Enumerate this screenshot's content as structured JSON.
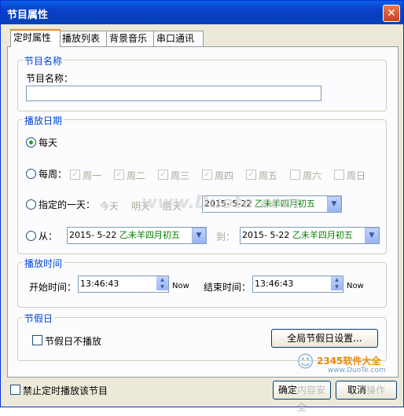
{
  "window": {
    "title": "节目属性",
    "close_glyph": "✕"
  },
  "tabs": [
    {
      "label": "定时属性"
    },
    {
      "label": "播放列表"
    },
    {
      "label": "背景音乐"
    },
    {
      "label": "串口通讯"
    }
  ],
  "program_name": {
    "group_label": "节目名称",
    "field_label": "节目名称：",
    "value": ""
  },
  "play_date": {
    "group_label": "播放日期",
    "everyday_label": "每天",
    "weekly_label": "每周：",
    "weekdays": [
      "周一",
      "周二",
      "周三",
      "周四",
      "周五",
      "周六",
      "周日"
    ],
    "weekdays_checked": [
      true,
      true,
      true,
      true,
      true,
      false,
      false
    ],
    "specific_label": "指定的一天：",
    "quick_days": [
      "今天",
      "明天",
      "后天"
    ],
    "specific_date": "2015- 5-22",
    "specific_lunar": "乙未羊四月初五",
    "from_label": "从：",
    "from_date": "2015- 5-22",
    "from_lunar": "乙未羊四月初五",
    "to_label": "到：",
    "to_date": "2015- 5-22",
    "to_lunar": "乙未羊四月初五",
    "selected": "everyday"
  },
  "play_time": {
    "group_label": "播放时间",
    "start_label": "开始时间：",
    "start_value": "13:46:43",
    "start_now": "Now",
    "end_label": "结束时间：",
    "end_value": "13:46:43",
    "end_now": "Now"
  },
  "holiday": {
    "group_label": "节假日",
    "no_play_label": "节假日不播放",
    "settings_button": "全局节假日设置..."
  },
  "footer": {
    "disable_label": "禁止定时播放该节目",
    "ok_button": "确定",
    "cancel_button": "取消",
    "watermark_text": "内容安全",
    "watermark_action": "操作"
  },
  "watermark": {
    "site": "www.Duote.com",
    "brand": "2345软件大全",
    "url": "www.DuoTe.com"
  },
  "colors": {
    "title_bar": "#0a4fd8",
    "group_label": "#0046d5",
    "lunar_text": "#008000",
    "tab_highlight": "#e68b2c"
  }
}
